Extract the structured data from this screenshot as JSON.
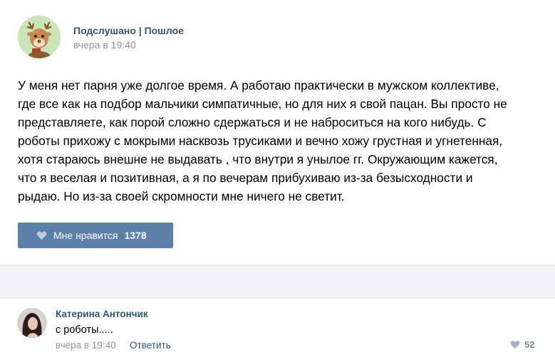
{
  "post": {
    "author": "Подслушано | Пошлое",
    "date": "вчера в 19:40",
    "text_lines": [
      "У меня нет парня уже долгое время. А работаю практически в мужском коллективе,",
      "где все как на подбор мальчики симпатичные, но для них я свой пацан. Вы просто не",
      "представляете, как порой сложно сдержаться и не наброситься на кого нибудь. С",
      "роботы прихожу с мокрыми насквозь трусиками и вечно хожу грустная и угнетенная,",
      "хотя стараюсь внешне не выдавать , что внутри я унылое гг. Окружающим кажется,",
      "что я веселая и позитивная, а я по вечерам прибухиваю из-за безысходности и",
      "рыдаю. Но из-за своей скромности мне ничего не светит."
    ],
    "like_label": "Мне нравится",
    "like_count": "1378"
  },
  "comment": {
    "author": "Катерина Антончик",
    "text": "с роботы.....",
    "date": "вчера в 19:40",
    "reply_label": "Ответить",
    "like_count": "52"
  },
  "colors": {
    "link": "#2a5885",
    "like_button": "#5b7fa6",
    "muted": "#939393"
  },
  "icons": {
    "post_avatar": "deer-avatar-icon",
    "like": "heart-icon",
    "comment_like": "heart-icon"
  }
}
